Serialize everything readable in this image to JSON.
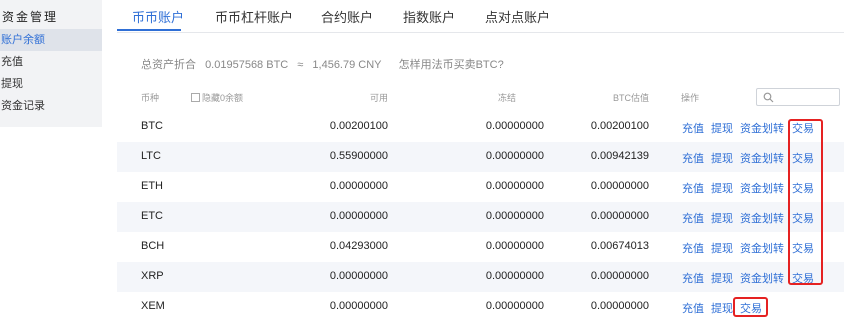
{
  "sidebar": {
    "title": "资金管理",
    "items": [
      {
        "label": "账户余额",
        "active": true
      },
      {
        "label": "充值",
        "active": false
      },
      {
        "label": "提现",
        "active": false
      },
      {
        "label": "资金记录",
        "active": false
      }
    ]
  },
  "tabs": [
    "币币账户",
    "币币杠杆账户",
    "合约账户",
    "指数账户",
    "点对点账户"
  ],
  "summary": {
    "label": "总资产折合",
    "btc": "0.01957568 BTC",
    "approx": "≈",
    "cny": "1,456.79 CNY",
    "link": "怎样用法币买卖BTC?"
  },
  "table": {
    "headers": {
      "coin": "币种",
      "hide_zero": "隐藏0余额",
      "available": "可用",
      "frozen": "冻结",
      "btc_value": "BTC估值",
      "action": "操作"
    },
    "rows": [
      {
        "coin": "BTC",
        "available": "0.00200100",
        "frozen": "0.00000000",
        "btc_value": "0.00200100",
        "actions": [
          "充值",
          "提现",
          "资金划转",
          "交易"
        ]
      },
      {
        "coin": "LTC",
        "available": "0.55900000",
        "frozen": "0.00000000",
        "btc_value": "0.00942139",
        "actions": [
          "充值",
          "提现",
          "资金划转",
          "交易"
        ]
      },
      {
        "coin": "ETH",
        "available": "0.00000000",
        "frozen": "0.00000000",
        "btc_value": "0.00000000",
        "actions": [
          "充值",
          "提现",
          "资金划转",
          "交易"
        ]
      },
      {
        "coin": "ETC",
        "available": "0.00000000",
        "frozen": "0.00000000",
        "btc_value": "0.00000000",
        "actions": [
          "充值",
          "提现",
          "资金划转",
          "交易"
        ]
      },
      {
        "coin": "BCH",
        "available": "0.04293000",
        "frozen": "0.00000000",
        "btc_value": "0.00674013",
        "actions": [
          "充值",
          "提现",
          "资金划转",
          "交易"
        ]
      },
      {
        "coin": "XRP",
        "available": "0.00000000",
        "frozen": "0.00000000",
        "btc_value": "0.00000000",
        "actions": [
          "充值",
          "提现",
          "资金划转",
          "交易"
        ]
      },
      {
        "coin": "XEM",
        "available": "0.00000000",
        "frozen": "0.00000000",
        "btc_value": "0.00000000",
        "actions": [
          "充值",
          "提现",
          "交易"
        ]
      }
    ]
  },
  "colors": {
    "accent": "#2f6fd6",
    "highlight": "#e52222",
    "row_alt": "#f4f6fa"
  },
  "icons": {
    "search": "search-icon"
  }
}
